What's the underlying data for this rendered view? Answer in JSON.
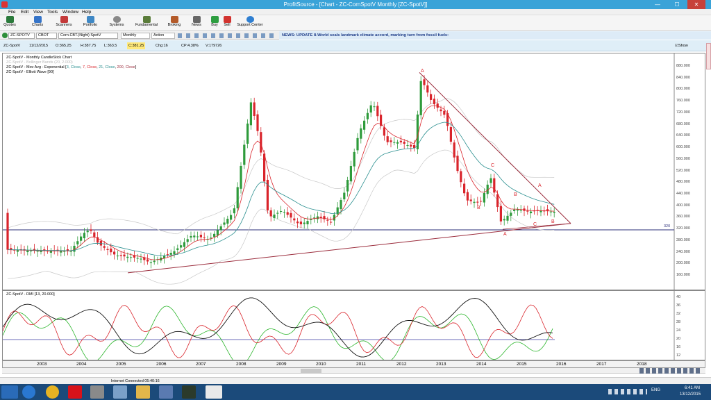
{
  "window": {
    "title": "ProfitSource - [Chart - ZC-CornSpotV Monthly [ZC-SpotV]]",
    "min": "—",
    "max": "☐",
    "close": "✕"
  },
  "menu": [
    "File",
    "Edit",
    "View",
    "Tools",
    "Window",
    "Help"
  ],
  "toolbar": [
    "Quotes",
    "Charts",
    "Scanners",
    "Portfolio",
    "Systems",
    "Fundamental",
    "Broking",
    "News",
    "Buy",
    "Sell",
    "Support Center"
  ],
  "ticker": {
    "symbol": "ZC-SPOTV",
    "exchange": "CBOT",
    "name": "Corn.CBT.(Night) SpotV",
    "period": "Monthly",
    "action": "Action"
  },
  "news": "NEWS: UPDATE 8-World seals landmark climate accord, marking turn from fossil fuels:",
  "quote": {
    "symbol": "ZC-SpotV",
    "date": "11/12/2015",
    "open": "O:365.25",
    "high": "H:387.75",
    "low": "L:363.5",
    "close": "C:381.25",
    "chg": "Chg:16",
    "cp": "CP:4.38%",
    "vol": "V:179726",
    "show_last": "Show Last"
  },
  "legend": {
    "l1": "ZC-SpotV - Monthly CandleStick Chart",
    "l2": "ZC-SpotV - Bollinger Bands (20, 2.000)",
    "l3_a": "ZC-SpotV - Mov Avg - Exponential [",
    "l3_b": "3, Close",
    "l3_c": "7, Close",
    "l3_d": "21, Close",
    "l3_e": "200, Close",
    "l3_f": "]",
    "l4": "ZC-SpotV - Elliott Wave [90]"
  },
  "dmi_legend": "ZC-SpotV - DMI [13, 20.000]",
  "price_axis": [
    "880.000",
    "840.000",
    "800.000",
    "760.000",
    "720.000",
    "680.000",
    "640.000",
    "600.000",
    "560.000",
    "520.000",
    "480.000",
    "440.000",
    "400.000",
    "360.000",
    "320.000",
    "280.000",
    "240.000",
    "200.000",
    "160.000"
  ],
  "support_label": "320",
  "dmi_axis": [
    "40",
    "36",
    "32",
    "28",
    "24",
    "20",
    "16",
    "12"
  ],
  "years": [
    "2003",
    "2004",
    "2005",
    "2006",
    "2007",
    "2008",
    "2009",
    "2010",
    "2011",
    "2012",
    "2013",
    "2014",
    "2015",
    "2016",
    "2017",
    "2018"
  ],
  "wave_labels": [
    "A",
    "B",
    "C",
    "A",
    "B",
    "C",
    "A",
    "B"
  ],
  "status": "Internet Connected 05:40:16",
  "clock": {
    "time": "6:41 AM",
    "date": "13/12/2015",
    "lang": "ENG"
  },
  "colors": {
    "titlebar": "#3aa3d8",
    "bull": "#2e9b3b",
    "bear": "#d9242b",
    "ema3": "#d9242b",
    "ema21": "#2a8f8f",
    "trend": "#9b2c3c"
  }
}
